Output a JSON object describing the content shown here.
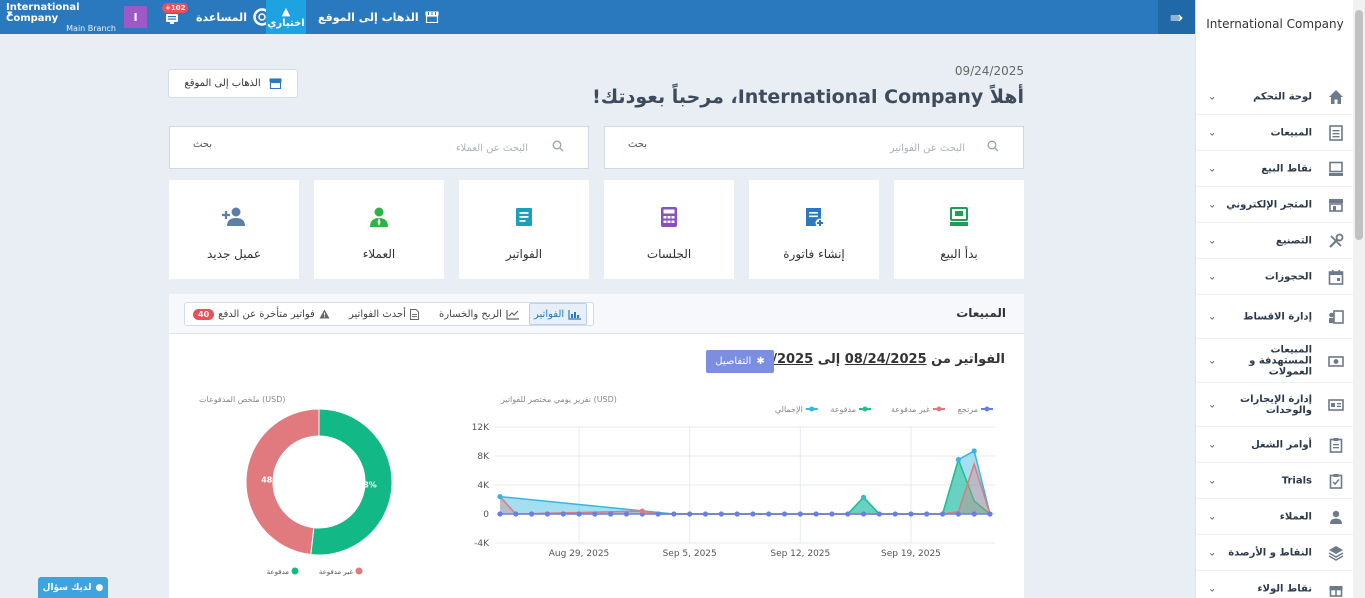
{
  "topbar": {
    "company_name": "International Company",
    "branch": "Main Branch",
    "user_initial": "I",
    "notifications_count": "+102",
    "help_label": "المساعدة",
    "trial_label": "اختياري",
    "goto_site_label": "الذهاب إلى الموقع"
  },
  "sidebar": {
    "brand": "International Company",
    "items": [
      {
        "label": "لوحة التحكم",
        "icon": "home-icon"
      },
      {
        "label": "المبيعات",
        "icon": "document-icon"
      },
      {
        "label": "نقاط البيع",
        "icon": "pos-icon"
      },
      {
        "label": "المتجر الإلكتروني",
        "icon": "store-icon"
      },
      {
        "label": "التصنيع",
        "icon": "tools-icon"
      },
      {
        "label": "الحجوزات",
        "icon": "calendar-icon"
      },
      {
        "label": "إدارة الاقساط",
        "icon": "installments-icon"
      },
      {
        "label": "المبيعات المستهدفة و العمولات",
        "icon": "money-icon"
      },
      {
        "label": "إدارة الإيجارات والوحدات",
        "icon": "rental-icon"
      },
      {
        "label": "أوامر الشغل",
        "icon": "clipboard-icon"
      },
      {
        "label": "Trials",
        "icon": "clipboard-check-icon"
      },
      {
        "label": "العملاء",
        "icon": "user-tie-icon"
      },
      {
        "label": "النقاط و الأرصدة",
        "icon": "layers-icon"
      },
      {
        "label": "نقاط الولاء",
        "icon": "gift-icon"
      }
    ]
  },
  "main": {
    "date": "09/24/2025",
    "welcome": "أهلاً International Company، مرحباً بعودتك!",
    "goto_site_label": "الذهاب إلى الموقع",
    "invoice_search": {
      "label": "بحث",
      "placeholder": "البحث عن الفواتير"
    },
    "client_search": {
      "label": "بحث",
      "placeholder": "البحث عن العملاء"
    },
    "tiles": [
      {
        "label": "بدأ البيع",
        "icon": "pos-icon",
        "color": "#1f9d55"
      },
      {
        "label": "إنشاء فاتورة",
        "icon": "add-invoice-icon",
        "color": "#2a79be"
      },
      {
        "label": "الجلسات",
        "icon": "calculator-icon",
        "color": "#8a4fc0"
      },
      {
        "label": "الفواتير",
        "icon": "invoice-icon",
        "color": "#1aa0b8"
      },
      {
        "label": "العملاء",
        "icon": "client-icon",
        "color": "#2fb344"
      },
      {
        "label": "عميل جديد",
        "icon": "add-user-icon",
        "color": "#5b7fa6"
      }
    ]
  },
  "sales": {
    "title": "المبيعات",
    "tabs": {
      "invoices": "الفواتير",
      "profit_loss": "الربح والخسارة",
      "latest": "أحدث الفواتير",
      "late": "فواتير متأخرة عن الدفع",
      "late_count": "40"
    },
    "range_prefix": "الفواتير من",
    "range_from": "08/24/2025",
    "range_to_word": "إلى",
    "range_to": "09/24/2025",
    "details_label": "التفاصيل"
  },
  "chart_data": [
    {
      "type": "area",
      "title": "تقرير يومي مختصر للفواتير (USD)",
      "legend": [
        "مرتجع",
        "غير مدفوعة",
        "مدفوعة",
        "الإجمالي"
      ],
      "legend_position": "top-right",
      "colors": {
        "مرتجع": "#6a7fe0",
        "غير مدفوعة": "#e07a7f",
        "مدفوعة": "#22c08a",
        "الإجمالي": "#34b7e0"
      },
      "y_ticks": [
        "12K",
        "8K",
        "4K",
        "0",
        "-4K"
      ],
      "ylim": [
        -4000,
        12000
      ],
      "x_ticks": [
        "Aug 29, 2025",
        "Sep 5, 2025",
        "Sep 12, 2025",
        "Sep 19, 2025"
      ],
      "x_start": "2025-08-24",
      "x_end": "2025-09-24",
      "grid": true,
      "series": [
        {
          "name": "الإجمالي",
          "x": [
            "2025-08-24",
            "2025-09-04",
            "2025-09-15",
            "2025-09-16",
            "2025-09-17",
            "2025-09-21",
            "2025-09-22",
            "2025-09-23",
            "2025-09-24"
          ],
          "y": [
            2400,
            0,
            0,
            2300,
            0,
            0,
            7500,
            8700,
            0
          ]
        },
        {
          "name": "مدفوعة",
          "x": [
            "2025-09-04",
            "2025-09-15",
            "2025-09-16",
            "2025-09-17",
            "2025-09-21",
            "2025-09-22",
            "2025-09-23",
            "2025-09-24"
          ],
          "y": [
            0,
            0,
            2300,
            0,
            0,
            7500,
            1800,
            0
          ]
        },
        {
          "name": "غير مدفوعة",
          "x": [
            "2025-08-24",
            "2025-08-25",
            "2025-09-02",
            "2025-09-03",
            "2025-09-21",
            "2025-09-22",
            "2025-09-23",
            "2025-09-24"
          ],
          "y": [
            2400,
            0,
            400,
            0,
            0,
            300,
            6900,
            0
          ]
        },
        {
          "name": "مرتجع",
          "x": [
            "2025-08-24",
            "2025-09-24"
          ],
          "y": [
            0,
            0
          ]
        }
      ]
    },
    {
      "type": "pie",
      "title": "ملخص المدفوعات (USD)",
      "donut": true,
      "slices": [
        {
          "name": "مدفوعة",
          "value": 51.8,
          "label": "51.8%",
          "color": "#12b886"
        },
        {
          "name": "غير مدفوعة",
          "value": 48.2,
          "label": "48.2%",
          "color": "#e07a7f"
        }
      ],
      "legend_position": "bottom"
    }
  ],
  "help_button": {
    "label": "لديك سؤال"
  }
}
